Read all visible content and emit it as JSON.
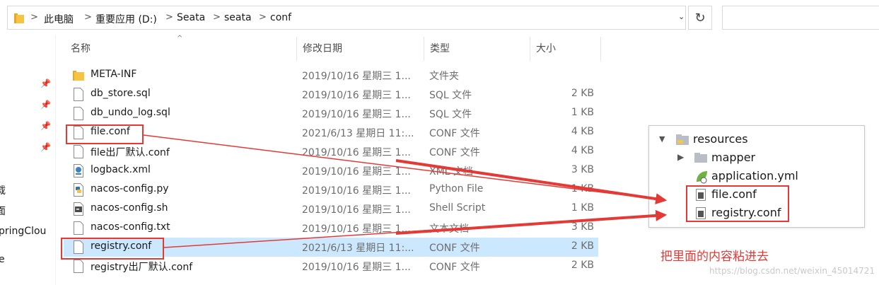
{
  "breadcrumb": [
    "此电脑",
    "重要应用 (D:)",
    "Seata",
    "seata",
    "conf"
  ],
  "nav_fragments": [
    "载",
    "面",
    "pringClou",
    "e"
  ],
  "columns": {
    "name": "名称",
    "date": "修改日期",
    "type": "类型",
    "size": "大小"
  },
  "files": [
    {
      "name": "META-INF",
      "date": "2019/10/16 星期三 1...",
      "type": "文件夹",
      "size": "",
      "icon": "folder-icon"
    },
    {
      "name": "db_store.sql",
      "date": "2019/10/16 星期三 1...",
      "type": "SQL 文件",
      "size": "2 KB",
      "icon": "file-icon"
    },
    {
      "name": "db_undo_log.sql",
      "date": "2019/10/16 星期三 1...",
      "type": "SQL 文件",
      "size": "1 KB",
      "icon": "file-icon"
    },
    {
      "name": "file.conf",
      "date": "2021/6/13 星期日 11:...",
      "type": "CONF 文件",
      "size": "4 KB",
      "icon": "file-icon"
    },
    {
      "name": "file出厂默认.conf",
      "date": "2019/10/16 星期三 1...",
      "type": "CONF 文件",
      "size": "4 KB",
      "icon": "file-icon"
    },
    {
      "name": "logback.xml",
      "date": "2019/10/16 星期三 1...",
      "type": "XML 文档",
      "size": "3 KB",
      "icon": "xml-file-icon"
    },
    {
      "name": "nacos-config.py",
      "date": "2019/10/16 星期三 1...",
      "type": "Python File",
      "size": "1 KB",
      "icon": "python-file-icon"
    },
    {
      "name": "nacos-config.sh",
      "date": "2019/10/16 星期三 1...",
      "type": "Shell Script",
      "size": "1 KB",
      "icon": "shell-file-icon"
    },
    {
      "name": "nacos-config.txt",
      "date": "2019/10/16 星期三 1...",
      "type": "文本文档",
      "size": "3 KB",
      "icon": "file-icon"
    },
    {
      "name": "registry.conf",
      "date": "2021/6/13 星期日 11:...",
      "type": "CONF 文件",
      "size": "2 KB",
      "icon": "file-icon",
      "selected": true
    },
    {
      "name": "registry出厂默认.conf",
      "date": "2019/10/16 星期三 1...",
      "type": "CONF 文件",
      "size": "2 KB",
      "icon": "file-icon"
    }
  ],
  "ide_tree": {
    "resources": "resources",
    "mapper": "mapper",
    "application": "application.yml",
    "file_conf": "file.conf",
    "registry_conf": "registry.conf"
  },
  "annotation_note": "把里面的内容粘进去",
  "watermark": "https://blog.csdn.net/weixin_45014721",
  "colors": {
    "highlight": "#e53935",
    "selection": "#cce8ff",
    "folder": "#f6c343"
  }
}
